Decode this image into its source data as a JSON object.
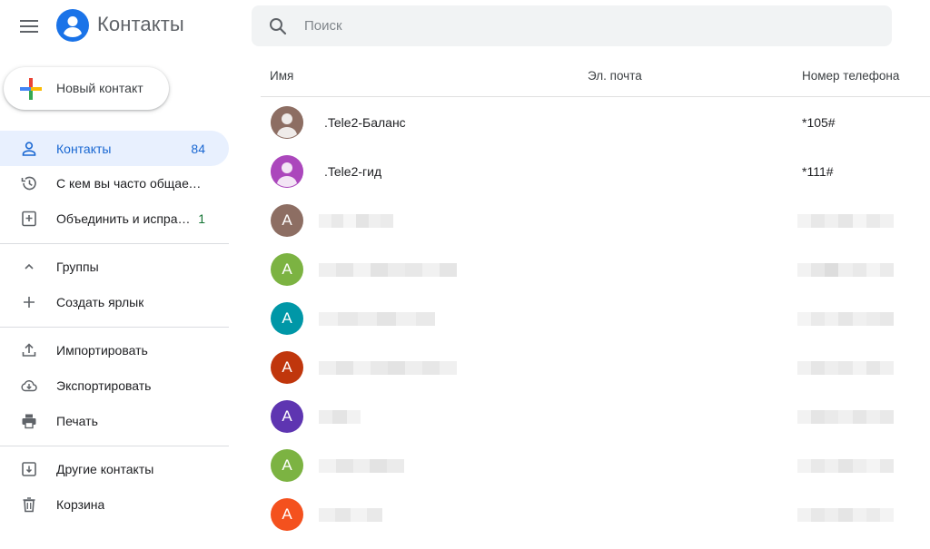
{
  "header": {
    "app_title": "Контакты",
    "menu_icon": "hamburger-menu-icon",
    "logo_icon": "contacts-logo-icon",
    "search_placeholder": "Поиск",
    "search_icon": "search-icon"
  },
  "sidebar": {
    "new_contact_label": "Новый контакт",
    "items": [
      {
        "label": "Контакты",
        "count": "84",
        "icon": "person-icon",
        "active": true
      },
      {
        "label": "С кем вы часто общаетесь",
        "icon": "history-icon"
      },
      {
        "label": "Объединить и исправить",
        "count": "1",
        "icon": "merge-icon"
      },
      {
        "label": "Группы",
        "icon": "chevron-up-icon"
      },
      {
        "label": "Создать ярлык",
        "icon": "plus-icon"
      },
      {
        "label": "Импортировать",
        "icon": "upload-icon"
      },
      {
        "label": "Экспортировать",
        "icon": "cloud-download-icon"
      },
      {
        "label": "Печать",
        "icon": "printer-icon"
      },
      {
        "label": "Другие контакты",
        "icon": "archive-icon"
      },
      {
        "label": "Корзина",
        "icon": "trash-icon"
      }
    ]
  },
  "table": {
    "columns": [
      "Имя",
      "Эл. почта",
      "Номер телефона"
    ],
    "rows": [
      {
        "name": ".Tele2-Баланс",
        "phone": "*105#",
        "avatar": "photo",
        "color": "#8d6e63"
      },
      {
        "name": ".Tele2-гид",
        "phone": "*111#",
        "avatar": "photo",
        "color": "#ab47bc"
      },
      {
        "initial": "А",
        "color": "#8d6e63"
      },
      {
        "initial": "А",
        "color": "#7cb342"
      },
      {
        "initial": "А",
        "color": "#0097a7"
      },
      {
        "initial": "А",
        "color": "#c0360c"
      },
      {
        "initial": "А",
        "color": "#5e35b1"
      },
      {
        "initial": "А",
        "color": "#7cb342"
      },
      {
        "initial": "А",
        "color": "#f4511e"
      }
    ]
  },
  "colors": {
    "accent": "#1a73e8",
    "active_bg": "#e8f0fe"
  }
}
